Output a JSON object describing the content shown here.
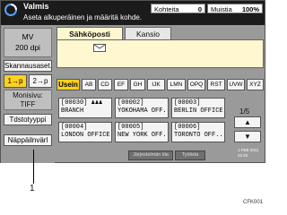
{
  "status": {
    "title": "Valmis",
    "subtitle": "Aseta alkuperäinen ja määritä kohde.",
    "memory_label": "Kohteita",
    "memory_value": "0",
    "storage_label": "Muistia",
    "storage_value": "100%"
  },
  "left": {
    "mode_line1": "MV",
    "mode_line2": "200 dpi",
    "scan_settings": "Skannausaset.",
    "dup_one": "1→p",
    "dup_two": "2→p",
    "multi_line1": "Monisivu:",
    "multi_line2": "TIFF",
    "file_type": "Tdstotyyppi",
    "color": "Näppäilnvärl"
  },
  "tabs": {
    "email": "Sähköposti",
    "folder": "Kansio"
  },
  "alpha": [
    "Usein",
    "AB",
    "CD",
    "EF",
    "GH",
    "IJK",
    "LMN",
    "OPQ",
    "RST",
    "UVW",
    "XYZ"
  ],
  "destinations": [
    {
      "id": "[00030]",
      "name": "BRANCH"
    },
    {
      "id": "[00002]",
      "name": "YOKOHAMA OFF.."
    },
    {
      "id": "[00003]",
      "name": "BERLIN OFFICE"
    },
    {
      "id": "[00004]",
      "name": "LONDON OFFICE"
    },
    {
      "id": "[00005]",
      "name": "NEW YORK OFF.."
    },
    {
      "id": "[00006]",
      "name": "TORONTO OFF.."
    }
  ],
  "page": "1/5",
  "arrows": {
    "up": "▲",
    "down": "▼"
  },
  "bottom": {
    "status_btn": "Järjestelmän tila",
    "jobs_btn": "Työlista"
  },
  "clock": {
    "line1": "1 FEB   2011",
    "line2": "22:20"
  },
  "callout": "1",
  "figure_code": "CFK001"
}
